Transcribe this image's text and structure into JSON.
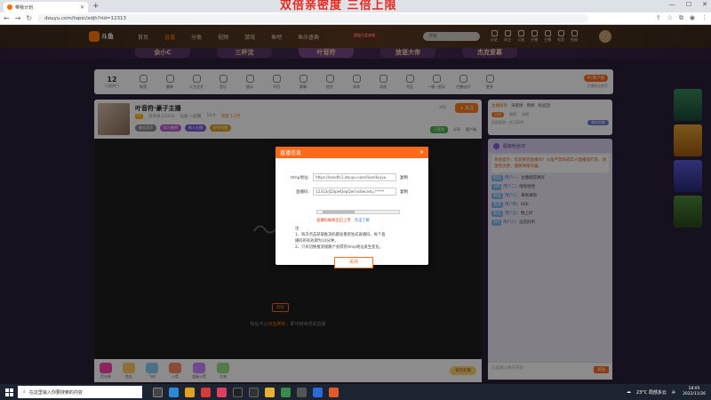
{
  "browser": {
    "tab_title": "带我计划",
    "url": "douyu.com/topic/xdjh?rid=12313",
    "overlay_banner": "双倍亲密度 三倍上限"
  },
  "header": {
    "logo_text": "斗鱼",
    "nav": [
      "首页",
      "直播",
      "分类",
      "视频",
      "游戏",
      "鱼吧",
      "鱼乐盛典"
    ],
    "ad_badge": "超级大奖来袭",
    "search_placeholder": "搜索",
    "icons": [
      "历史",
      "关注",
      "订阅",
      "开播",
      "主播",
      "电竞",
      "鱼翅"
    ]
  },
  "banner_tabs": [
    "余小C",
    "三杯沈",
    "叶音符",
    "放逐大帝",
    "杰克爱慕"
  ],
  "categories": {
    "count": "12",
    "count_label": "分类热门",
    "items": [
      "推荐",
      "最新",
      "火力全开",
      "音乐",
      "娱乐",
      "节目",
      "赛事",
      "综艺",
      "体育",
      "游戏",
      "专区",
      "一键一起玩",
      "主播派对",
      "更多"
    ],
    "pc_client": "PC客户端",
    "right_sub": "主播精选推荐"
  },
  "room": {
    "title": "叶音符·豪子主播",
    "level": "LV",
    "sub": [
      "房间号:12313",
      "分类:一起看",
      "16:9",
      "热度 1.2万"
    ],
    "tags": [
      "最佳男声",
      "实力唱将",
      "新人主播",
      "好评如潮"
    ],
    "report": "举报",
    "follow_label": "+ 关注",
    "share": [
      "分享",
      "客户端"
    ],
    "attend": "已签到",
    "tip_text": "稍后可以",
    "tip_link": "点击刷新",
    "tip_text2": "，即可继续观看直播",
    "tip_btn": "刷新"
  },
  "gifts": [
    "荧光棒",
    "鱼丸",
    "飞机",
    "火箭",
    "超级火箭",
    "礼物"
  ],
  "gift_promo": "背包礼物",
  "rank": {
    "tabs": [
      "主播榜单",
      "贡献榜",
      "周榜",
      "粉丝团"
    ],
    "sub": [
      "日榜",
      "周榜",
      "总榜"
    ],
    "tip": "贡献值第一名可获得",
    "btn": "我的贡献"
  },
  "chat": {
    "head": "超级粉丝日",
    "notice": "系统提示：欢迎来到直播间！斗鱼严禁未成年人直播或打赏。请理性消费，谨防网络诈骗。",
    "messages": [
      {
        "badge": "粉丝",
        "name": "用户一",
        "text": "主播唱得真好"
      },
      {
        "badge": "VIP",
        "name": "用户二",
        "text": "哈哈哈哈"
      },
      {
        "badge": "粉丝",
        "name": "用户三",
        "text": "来啦来啦"
      },
      {
        "badge": "贵族",
        "name": "用户四",
        "text": "666"
      },
      {
        "badge": "粉丝",
        "name": "用户五",
        "text": "晚上好"
      },
      {
        "badge": "VIP",
        "name": "用户六",
        "text": "这首好听"
      }
    ],
    "input_placeholder": "这里输入聊天内容",
    "send": "发送"
  },
  "modal": {
    "title": "直播信息",
    "rtmp_label": "rtmp地址:",
    "rtmp_value": "https://sendfc1.douyu.com/live/douyu",
    "key_label": "直播码:",
    "key_value": "12313rjD3pHQepQw?xsSecret=*****",
    "copy": "复制",
    "warn": "直播码被刷出已上传",
    "warn_link": "点击了解",
    "notes": [
      "注:",
      "1、每次点击获取推流码都会重新生成直播码，每个直",
      "   播码的有效期为10分钟。",
      "2、只有切换推流线路才会得到rtmp地址发生变化。"
    ],
    "close_label": "关闭"
  },
  "taskbar": {
    "search_placeholder": "在这里输入你要搜索的内容",
    "weather": "23°C 局部多云",
    "time": "18:05",
    "date": "2022/11/26"
  },
  "colors": {
    "accent": "#ff6a1a",
    "header_bg": "#3b2a1c",
    "modal_head": "#ff6a1a"
  }
}
